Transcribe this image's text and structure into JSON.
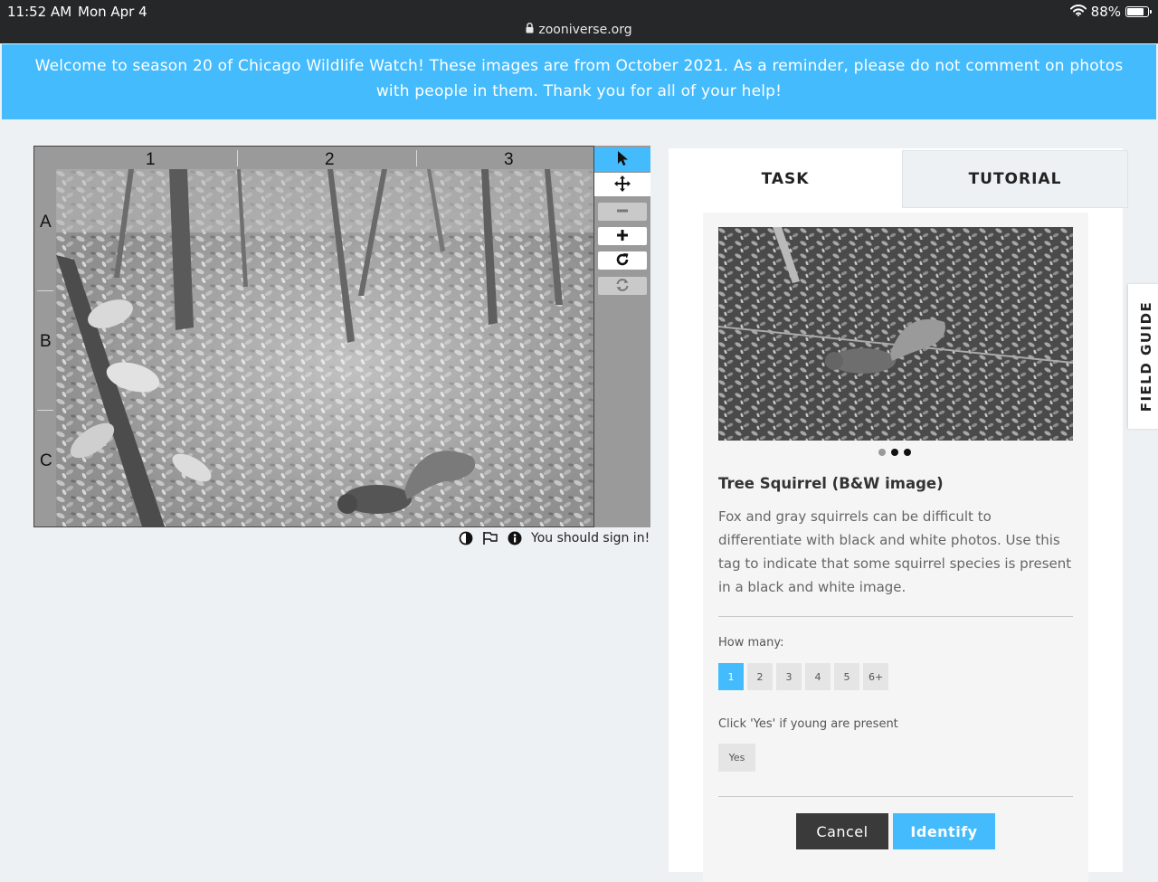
{
  "status_bar": {
    "time": "11:52 AM",
    "date": "Mon Apr 4",
    "url": "zooniverse.org",
    "battery": "88%",
    "battery_level": 0.88
  },
  "banner": {
    "text": "Welcome to season 20 of Chicago Wildlife Watch! These images are from October 2021. As a reminder, please do not comment on photos with people in them. Thank you for all of your help!"
  },
  "viewer": {
    "grid_columns": [
      "1",
      "2",
      "3"
    ],
    "grid_rows": [
      "A",
      "B",
      "C"
    ],
    "tools": [
      {
        "name": "pointer-icon"
      },
      {
        "name": "move-icon"
      },
      {
        "name": "zoom-out-icon"
      },
      {
        "name": "zoom-in-icon"
      },
      {
        "name": "rotate-icon"
      },
      {
        "name": "reset-icon"
      }
    ],
    "sign_in_message": "You should sign in!"
  },
  "task_panel": {
    "tabs": {
      "task": "TASK",
      "tutorial": "TUTORIAL"
    },
    "species_name": "Tree Squirrel (B&W image)",
    "description": "Fox and gray squirrels can be difficult to differentiate with black and white photos. Use this tag to indicate that some squirrel species is present in a black and white image.",
    "carousel_count": 3,
    "carousel_active": 0,
    "how_many_label": "How many:",
    "counts": [
      "1",
      "2",
      "3",
      "4",
      "5",
      "6+"
    ],
    "selected_count": "1",
    "young_label": "Click 'Yes' if young are present",
    "yes_label": "Yes",
    "cancel_label": "Cancel",
    "identify_label": "Identify"
  },
  "field_guide": {
    "label": "FIELD GUIDE"
  },
  "colors": {
    "accent": "#43bbfd",
    "status_bar_bg": "#252729",
    "page_bg": "#eef1f4",
    "cancel_bg": "#3a3a3a"
  }
}
